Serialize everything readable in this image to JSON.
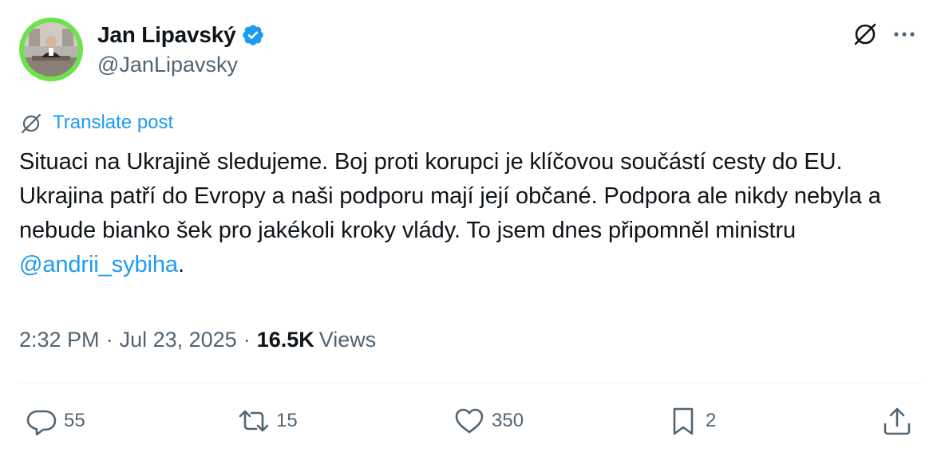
{
  "author": {
    "display_name": "Jan Lipavský",
    "handle": "@JanLipavsky",
    "verified_icon": "verified-badge-icon",
    "avatar_ring_color": "#6ce34a"
  },
  "header": {
    "grok_icon": "grok-icon",
    "more_icon": "more-dots-icon"
  },
  "translate": {
    "label": "Translate post",
    "icon": "translate-globe-icon"
  },
  "body": {
    "text_before_mention": "Situaci na Ukrajině sledujeme. Boj proti korupci je klíčovou součástí cesty do EU. Ukrajina patří do Evropy a naši podporu mají její občané. Podpora ale nikdy nebyla a nebude bianko šek pro jakékoli kroky vlády. To jsem dnes připomněl ministru ",
    "mention": "@andrii_sybiha",
    "text_after_mention": "."
  },
  "meta": {
    "time": "2:32 PM",
    "separator": "·",
    "date": "Jul 23, 2025",
    "views_count": "16.5K",
    "views_label": "Views"
  },
  "actions": {
    "replies": "55",
    "reposts": "15",
    "likes": "350",
    "bookmarks": "2"
  },
  "colors": {
    "link": "#1d9bf0",
    "secondary_text": "#536471",
    "primary_text": "#0f1419"
  }
}
